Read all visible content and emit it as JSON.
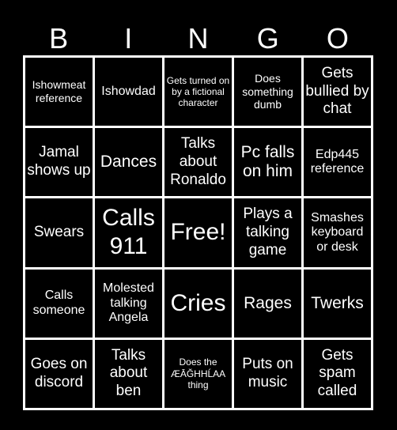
{
  "header": {
    "letters": [
      "B",
      "I",
      "N",
      "G",
      "O"
    ]
  },
  "colors": {
    "background": "#000000",
    "text": "#ffffff",
    "grid_lines": "#ffffff"
  },
  "cells": [
    [
      "Ishowmeat reference",
      "Ishowdad",
      "Gets turned on by a fictional character",
      "Does something dumb",
      "Gets bullied by chat"
    ],
    [
      "Jamal shows up",
      "Dances",
      "Talks about Ronaldo",
      "Pc falls on him",
      "Edp445 reference"
    ],
    [
      "Swears",
      "Calls 911",
      "Free!",
      "Plays a talking game",
      "Smashes keyboard or desk"
    ],
    [
      "Calls someone",
      "Molested talking Angela",
      "Cries",
      "Rages",
      "Twerks"
    ],
    [
      "Goes on discord",
      "Talks about ben",
      "Does the ÆĀĞHHĹAA thing",
      "Puts on music",
      "Gets spam called"
    ]
  ]
}
